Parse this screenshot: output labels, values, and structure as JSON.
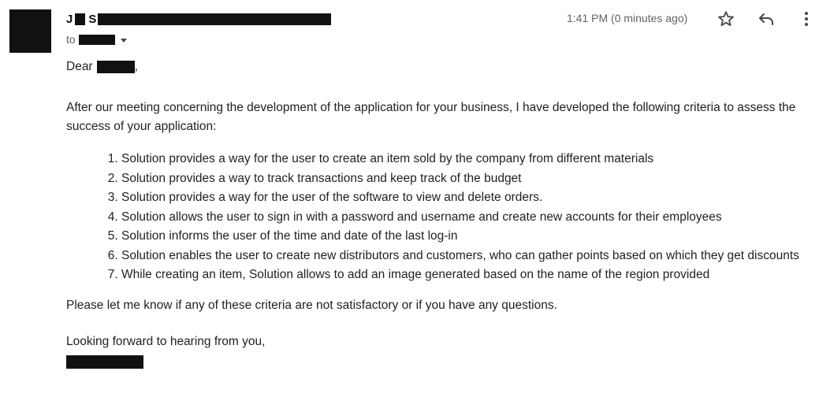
{
  "email": {
    "sender_initial_first": "J",
    "sender_initial_last": "S",
    "to_label": "to",
    "time": "1:41 PM (0 minutes ago)",
    "greeting": "Dear",
    "greeting_punct": ",",
    "intro": "After our meeting concerning the development of the application for your business, I have developed the following criteria to assess the success of your application:",
    "criteria": [
      "Solution provides a way for the user to create an item sold by the company from different materials",
      "Solution provides a way to track transactions and keep track of the budget",
      "Solution provides a way for the user of the software to view and delete orders.",
      "Solution allows the user to sign in with a password and username and create new accounts for their employees",
      "Solution informs the user of the time and date of the last log-in",
      "Solution enables the user to create new distributors and customers, who can gather points based on which they get discounts",
      "While creating an item, Solution allows to add an image generated based on the name of the region provided"
    ],
    "question": "Please let me know if any of these criteria are not satisfactory or if you have any questions.",
    "closing": "Looking forward to hearing from you,"
  },
  "icons": {
    "star": "star-icon",
    "reply": "reply-icon",
    "more": "more-vert-icon",
    "recipients": "chevron-down-icon"
  },
  "colors": {
    "text": "#222222",
    "meta": "#5f6368",
    "redaction": "#111111"
  }
}
